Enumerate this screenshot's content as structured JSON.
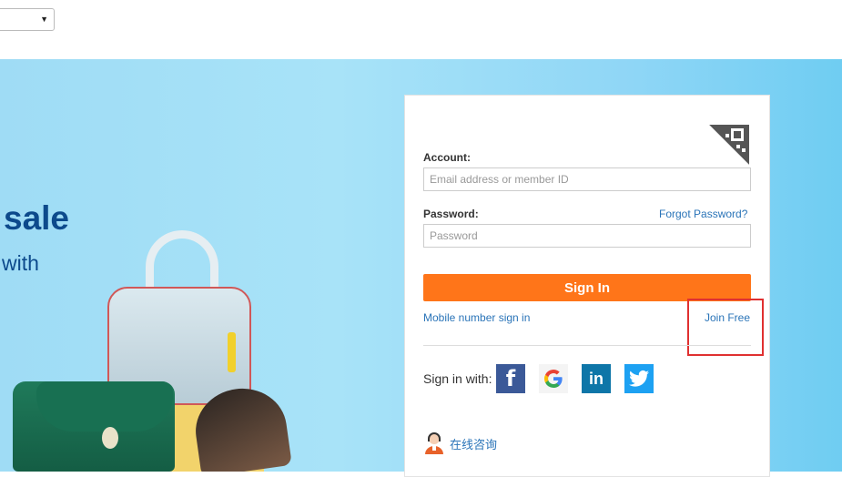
{
  "language_select": {
    "value": ""
  },
  "hero": {
    "title": "sale",
    "subtitle": "with"
  },
  "login": {
    "account_label": "Account:",
    "account_placeholder": "Email address or member ID",
    "password_label": "Password:",
    "password_placeholder": "Password",
    "forgot_password": "Forgot Password?",
    "sign_in_button": "Sign In",
    "mobile_sign_in": "Mobile number sign in",
    "join_free": "Join Free",
    "sign_in_with": "Sign in with:",
    "social": [
      {
        "name": "facebook-icon",
        "glyph": "f"
      },
      {
        "name": "google-icon",
        "glyph": "G"
      },
      {
        "name": "linkedin-icon",
        "glyph": "in"
      },
      {
        "name": "twitter-icon",
        "glyph": ""
      }
    ],
    "consult_link": "在线咨询"
  },
  "colors": {
    "accent": "#ff7519",
    "link": "#2a74b8",
    "hero_text": "#0d4a8c",
    "highlight": "#e03030"
  }
}
